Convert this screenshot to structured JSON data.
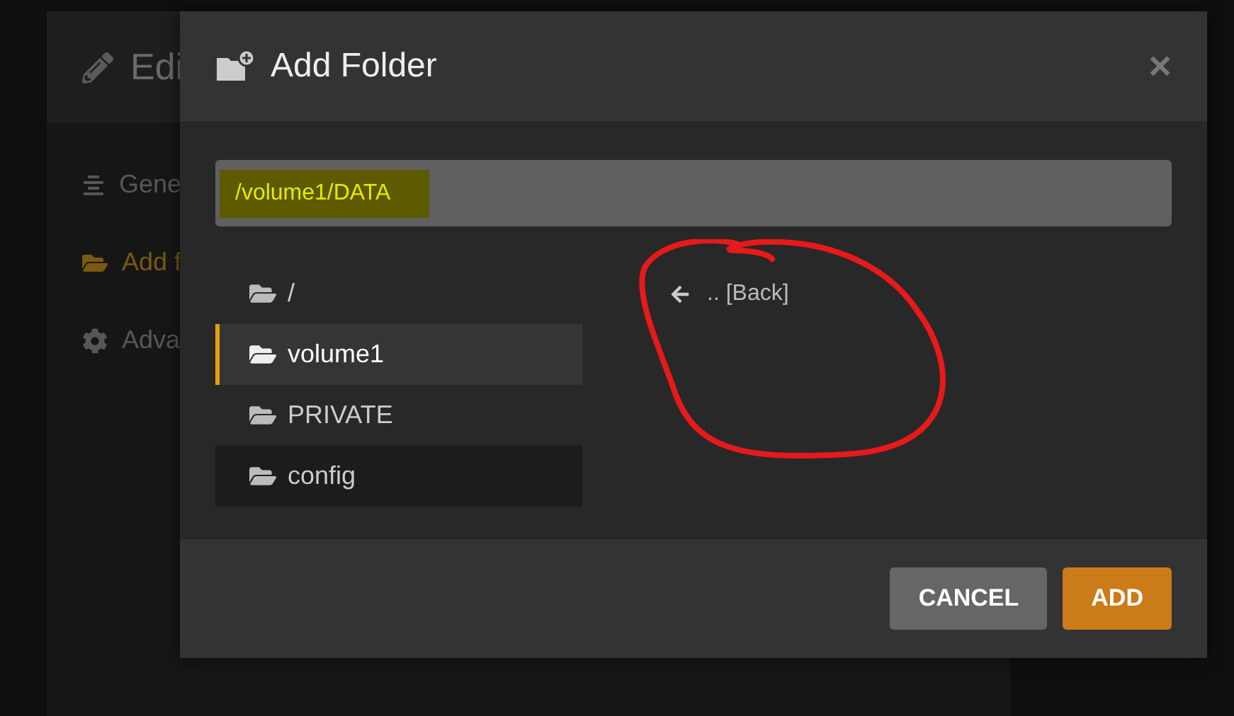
{
  "background": {
    "dialog_title": "Edi",
    "sidebar_items": [
      {
        "label": "Gene",
        "selected": false
      },
      {
        "label": "Add f",
        "selected": true
      },
      {
        "label": "Adva",
        "selected": false
      }
    ]
  },
  "dialog": {
    "title": "Add Folder",
    "close": "×",
    "path_value": "/volume1/DATA",
    "folders": [
      {
        "name": "/",
        "selected": false,
        "hovered": false
      },
      {
        "name": "volume1",
        "selected": true,
        "hovered": false
      },
      {
        "name": "PRIVATE",
        "selected": false,
        "hovered": false
      },
      {
        "name": "config",
        "selected": false,
        "hovered": true
      }
    ],
    "contents": [
      {
        "label": ".. [Back]"
      }
    ],
    "buttons": [
      {
        "label": "CANCEL",
        "kind": "secondary"
      },
      {
        "label": "ADD",
        "kind": "primary"
      }
    ]
  }
}
